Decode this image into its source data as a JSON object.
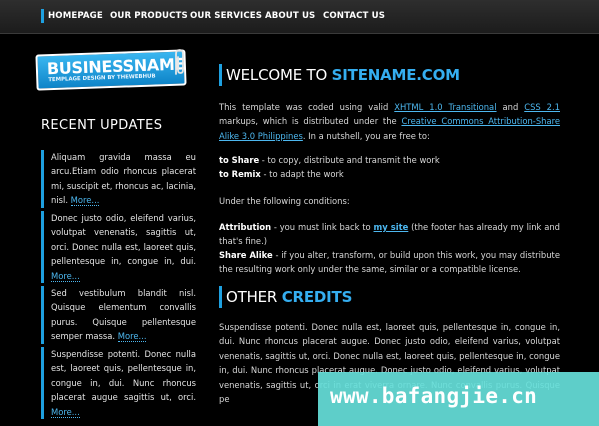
{
  "nav": [
    "HOMEPAGE",
    "OUR PRODUCTS",
    "OUR SERVICES",
    "ABOUT US",
    "CONTACT US"
  ],
  "logo": {
    "name": "BUSINESSNAME",
    "tagline": "TEMPLAGE DESIGN BY THEWEBHUB"
  },
  "sidebar": {
    "title": "RECENT UPDATES",
    "more": "More...",
    "updates": [
      "Aliquam gravida massa eu arcu.Etiam odio rhoncus placerat mi, suscipit et, rhoncus ac, lacinia, nisl.",
      "Donec justo odio, eleifend varius, volutpat venenatis, sagittis ut, orci. Donec nulla est, laoreet quis, pellentesque in, congue in, dui.",
      "Sed vestibulum blandit nisl. Quisque elementum convallis purus. Quisque pellentesque semper massa.",
      "Suspendisse potenti. Donec nulla est, laoreet quis, pellentesque in, congue in, dui. Nunc rhoncus placerat augue sagittis ut, orci."
    ]
  },
  "main": {
    "welcome_prefix": "WELCOME TO ",
    "welcome_site": "SITENAME.COM",
    "intro_1": "This template was coded using valid ",
    "intro_link1": "XHTML 1.0 Transitional",
    "intro_2": " and ",
    "intro_link2": "CSS 2.1",
    "intro_3": " markups, which is distributed under the ",
    "intro_link3": "Creative Commons Attribution-Share Alike 3.0 Philippines",
    "intro_4": ". In a nutshell, you are free to:",
    "share_label": "to Share",
    "share_text": " - to copy, distribute and transmit the work",
    "remix_label": "to Remix",
    "remix_text": " - to adapt the work",
    "conditions": "Under the following conditions:",
    "attr_label": "Attribution",
    "attr_1": " - you must link back to ",
    "attr_link": "my site",
    "attr_2": " (the footer has already my link and that's fine.)",
    "sa_label": "Share Alike",
    "sa_text": " - if you alter, transform, or build upon this work, you may distribute the resulting work only under the same, similar or a compatible license.",
    "credits_prefix": "OTHER ",
    "credits_word": "CREDITS",
    "credits_text": "Suspendisse potenti. Donec nulla est, laoreet quis, pellentesque in, congue in, dui. Nunc rhoncus placerat augue. Donec justo odio, eleifend varius, volutpat venenatis, sagittis ut, orci. Donec nulla est, laoreet quis, pellentesque in, congue in, dui. Nunc rhoncus placerat augue. Donec justo odio, eleifend varius, volutpat venenatis, sagittis ut, orci in erat viverra ornare. Nunc convallis purus. Quisque pe"
  },
  "watermark": "www.bafangjie.cn",
  "colors": {
    "accent": "#1ea0e0",
    "background": "#000000",
    "watermark": "#66e0da"
  }
}
